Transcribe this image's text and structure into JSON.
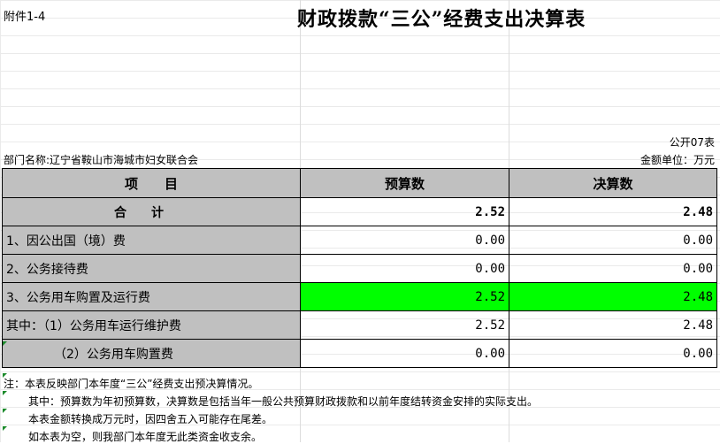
{
  "header": {
    "attachment": "附件1-4",
    "title": "财政拨款“三公”经费支出决算表",
    "table_code": "公开07表",
    "department": "部门名称:辽宁省鞍山市海城市妇女联合会",
    "unit": "金额单位：万元"
  },
  "table": {
    "columns": [
      "项　　目",
      "预算数",
      "决算数"
    ],
    "total_label": "合计",
    "total_budget": "2.52",
    "total_final": "2.48",
    "rows": [
      {
        "label": "1、因公出国（境）费",
        "budget": "0.00",
        "final": "0.00"
      },
      {
        "label": "2、公务接待费",
        "budget": "0.00",
        "final": "0.00"
      },
      {
        "label": "3、公务用车购置及运行费",
        "budget": "2.52",
        "final": "2.48"
      },
      {
        "label": "其中：（1）公务用车运行维护费",
        "budget": "2.52",
        "final": "2.48"
      },
      {
        "label": "（2）公务用车购置费",
        "budget": "0.00",
        "final": "0.00"
      }
    ],
    "highlight_color": "#00ff00",
    "header_color": "#c0c0c0"
  },
  "notes": [
    "注：本表反映部门本年度“三公”经费支出预决算情况。",
    "其中：预算数为年初预算数，决算数是包括当年一般公共预算财政拨款和以前年度结转资金安排的实际支出。",
    "本表金额转换成万元时，因四舍五入可能存在尾差。",
    "如本表为空，则我部门本年度无此类资金收支余。"
  ]
}
